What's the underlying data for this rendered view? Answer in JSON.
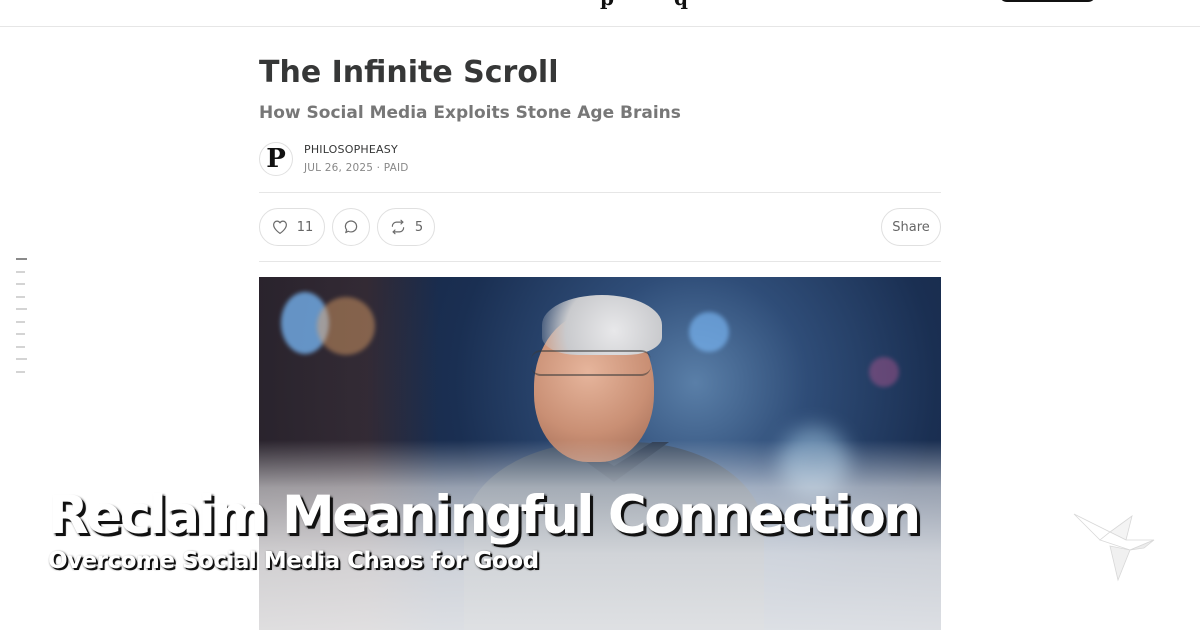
{
  "article": {
    "title": "The Infinite Scroll",
    "subtitle": "How Social Media Exploits Stone Age Brains",
    "author": "PHILOSOPHEASY",
    "meta": "JUL 26, 2025 · PAID",
    "avatar_letter": "P"
  },
  "actions": {
    "like_count": "11",
    "restack_count": "5",
    "share_label": "Share"
  },
  "icons": {
    "like": "heart-icon",
    "comment": "comment-bubble-icon",
    "restack": "restack-arrows-icon",
    "brand": "origami-bird-icon"
  },
  "banner": {
    "title": "Reclaim Meaningful Connection",
    "subtitle": "Overcome Social Media Chaos for Good"
  },
  "colors": {
    "text": "#363737",
    "muted": "#777777",
    "border": "#e6e6e6",
    "banner_text": "#ffffff"
  }
}
